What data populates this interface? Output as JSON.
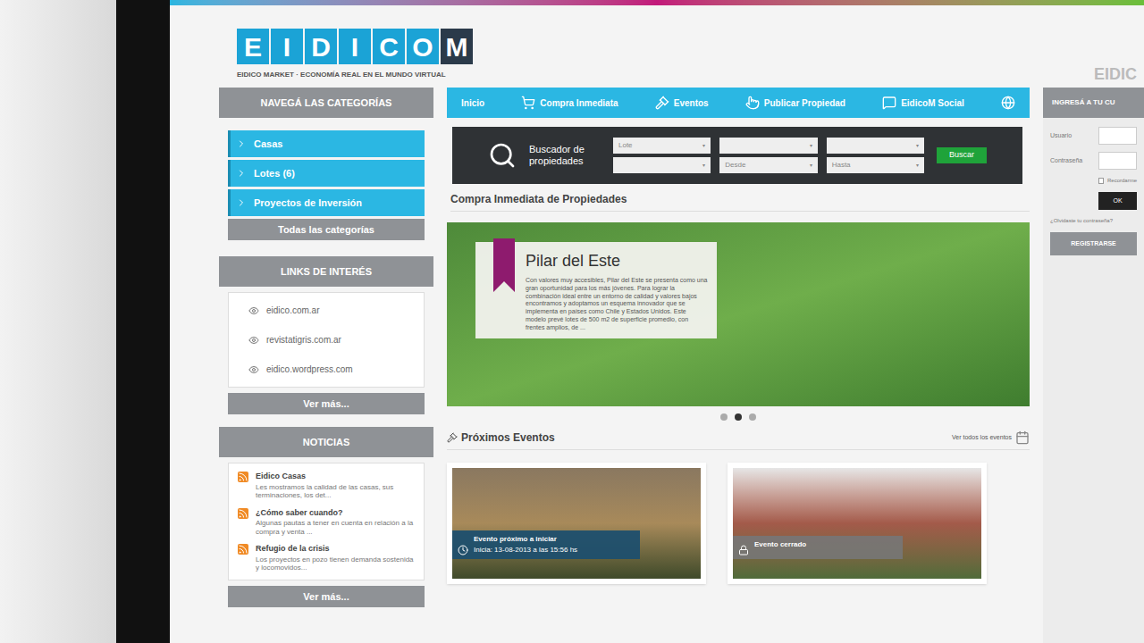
{
  "corner_text": "EIDIC",
  "logo": {
    "letters": [
      {
        "char": "E",
        "dark": false
      },
      {
        "char": "I",
        "dark": false
      },
      {
        "char": "D",
        "dark": false
      },
      {
        "char": "I",
        "dark": false
      },
      {
        "char": "C",
        "dark": false
      },
      {
        "char": "O",
        "dark": false
      },
      {
        "char": "M",
        "dark": true
      }
    ],
    "tagline": "EIDICO MARKET · ECONOMÍA REAL EN EL MUNDO VIRTUAL"
  },
  "sidebar": {
    "categories": {
      "title": "NAVEGÁ LAS CATEGORÍAS",
      "items": [
        {
          "label": "Casas"
        },
        {
          "label": "Lotes (6)"
        },
        {
          "label": "Proyectos de Inversión"
        }
      ],
      "all": "Todas las categorías"
    },
    "links": {
      "title": "LINKS DE INTERÉS",
      "items": [
        "eidico.com.ar",
        "revistatigris.com.ar",
        "eidico.wordpress.com"
      ],
      "more": "Ver más..."
    },
    "news": {
      "title": "NOTICIAS",
      "items": [
        {
          "title": "Eidico Casas",
          "summary": "Les mostramos la calidad de las casas, sus terminaciones, los det..."
        },
        {
          "title": "¿Cómo saber cuando?",
          "summary": "Algunas pautas a tener en cuenta en relación a la compra y venta ..."
        },
        {
          "title": "Refugio de la crisis",
          "summary": "Los proyectos en pozo tienen demanda sostenida y locomovidos..."
        }
      ],
      "more": "Ver más..."
    }
  },
  "nav": {
    "items": [
      {
        "label": "Inicio",
        "icon": "none"
      },
      {
        "label": "Compra Inmediata",
        "icon": "cart"
      },
      {
        "label": "Eventos",
        "icon": "gavel"
      },
      {
        "label": "Publicar Propiedad",
        "icon": "pointer"
      },
      {
        "label": "EidicoM Social",
        "icon": "chat"
      }
    ]
  },
  "search": {
    "title": "Buscador de propiedades",
    "fields": [
      "Lote",
      "",
      "",
      "",
      "Desde",
      "Hasta"
    ],
    "button": "Buscar"
  },
  "featured": {
    "heading": "Compra Inmediata de Propiedades",
    "slide": {
      "title": "Pilar del Este",
      "text": "Con valores muy accesibles, Pilar del Este se presenta como una gran oportunidad para los más jóvenes. Para lograr la combinación ideal entre un entorno de calidad y valores bajos encontramos y adoptamos un esquema innovador que se implementa en países como Chile y Estados Unidos. Este modelo prevé lotes de 500 m2 de superficie promedio, con frentes amplios, de ..."
    },
    "dots": [
      {
        "selected": false
      },
      {
        "selected": true
      },
      {
        "selected": false
      }
    ]
  },
  "events": {
    "heading": "Próximos Eventos",
    "link": "Ver todos los eventos",
    "cards": [
      {
        "status": "Evento próximo a iniciar",
        "start": "Inicia: 13-08-2013 a las 15:56 hs",
        "closed": false
      },
      {
        "status": "Evento cerrado",
        "start": "",
        "closed": true
      }
    ]
  },
  "login": {
    "title": "INGRESÁ A TU CU",
    "fields": [
      "Usuario",
      "Contraseña"
    ],
    "remember": "Recordarme",
    "remember_checked": false,
    "button": "OK",
    "forgot": "¿Olvidaste tu contraseña?",
    "register": "REGISTRARSE"
  }
}
